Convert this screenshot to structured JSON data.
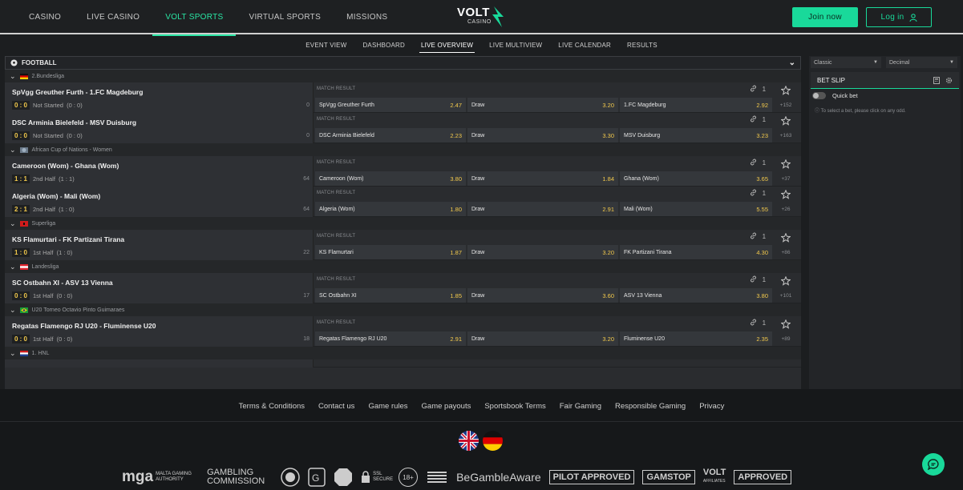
{
  "nav": {
    "items": [
      "CASINO",
      "LIVE CASINO",
      "VOLT SPORTS",
      "VIRTUAL SPORTS",
      "MISSIONS"
    ],
    "active_index": 2
  },
  "logo": {
    "title": "VOLT",
    "subtitle": "CASINO"
  },
  "auth": {
    "join_label": "Join now",
    "login_label": "Log in"
  },
  "subnav": {
    "items": [
      "EVENT VIEW",
      "DASHBOARD",
      "LIVE OVERVIEW",
      "LIVE MULTIVIEW",
      "LIVE CALENDAR",
      "RESULTS"
    ],
    "active_index": 2
  },
  "sport": {
    "label": "FOOTBALL"
  },
  "market_label": "MATCH RESULT",
  "leagues": [
    {
      "name": "2.Bundesliga",
      "flag": "germany",
      "matches": [
        {
          "name": "SpVgg Greuther Furth - 1.FC Magdeburg",
          "score": "0 : 0",
          "status": "Not Started",
          "period": "(0 : 0)",
          "minute": "0",
          "links": "1",
          "home": "SpVgg Greuther Furth",
          "home_odd": "2.47",
          "draw": "Draw",
          "draw_odd": "3.20",
          "away": "1.FC Magdeburg",
          "away_odd": "2.92",
          "more": "+152"
        },
        {
          "name": "DSC Arminia Bielefeld - MSV Duisburg",
          "score": "0 : 0",
          "status": "Not Started",
          "period": "(0 : 0)",
          "minute": "0",
          "links": "1",
          "home": "DSC Arminia Bielefeld",
          "home_odd": "2.23",
          "draw": "Draw",
          "draw_odd": "3.30",
          "away": "MSV Duisburg",
          "away_odd": "3.23",
          "more": "+163"
        }
      ]
    },
    {
      "name": "African Cup of Nations - Women",
      "flag": "world",
      "matches": [
        {
          "name": "Cameroon (Wom) - Ghana (Wom)",
          "score": "1 : 1",
          "status": "2nd Half",
          "period": "(1 : 1)",
          "minute": "64",
          "links": "1",
          "home": "Cameroon (Wom)",
          "home_odd": "3.80",
          "draw": "Draw",
          "draw_odd": "1.84",
          "away": "Ghana (Wom)",
          "away_odd": "3.65",
          "more": "+37"
        },
        {
          "name": "Algeria (Wom) - Mali (Wom)",
          "score": "2 : 1",
          "status": "2nd Half",
          "period": "(1 : 0)",
          "minute": "64",
          "links": "1",
          "home": "Algeria (Wom)",
          "home_odd": "1.80",
          "draw": "Draw",
          "draw_odd": "2.91",
          "away": "Mali (Wom)",
          "away_odd": "5.55",
          "more": "+26"
        }
      ]
    },
    {
      "name": "Superliga",
      "flag": "albania",
      "matches": [
        {
          "name": "KS Flamurtari - FK Partizani Tirana",
          "score": "1 : 0",
          "status": "1st Half",
          "period": "(1 : 0)",
          "minute": "22",
          "links": "1",
          "home": "KS Flamurtari",
          "home_odd": "1.87",
          "draw": "Draw",
          "draw_odd": "3.20",
          "away": "FK Partizani Tirana",
          "away_odd": "4.30",
          "more": "+86"
        }
      ]
    },
    {
      "name": "Landesliga",
      "flag": "austria",
      "matches": [
        {
          "name": "SC Ostbahn XI - ASV 13 Vienna",
          "score": "0 : 0",
          "status": "1st Half",
          "period": "(0 : 0)",
          "minute": "17",
          "links": "1",
          "home": "SC Ostbahn XI",
          "home_odd": "1.85",
          "draw": "Draw",
          "draw_odd": "3.60",
          "away": "ASV 13 Vienna",
          "away_odd": "3.80",
          "more": "+101"
        }
      ]
    },
    {
      "name": "U20 Torneo Octavio Pinto Guimaraes",
      "flag": "brazil",
      "matches": [
        {
          "name": "Regatas Flamengo RJ U20 - Fluminense U20",
          "score": "0 : 0",
          "status": "1st Half",
          "period": "(0 : 0)",
          "minute": "18",
          "links": "1",
          "home": "Regatas Flamengo RJ U20",
          "home_odd": "2.91",
          "draw": "Draw",
          "draw_odd": "3.20",
          "away": "Fluminense U20",
          "away_odd": "2.35",
          "more": "+89"
        }
      ]
    },
    {
      "name": "1. HNL",
      "flag": "croatia",
      "matches": []
    }
  ],
  "sidebar": {
    "view_select": "Classic",
    "odds_select": "Decimal",
    "betslip_title": "BET SLIP",
    "quick_bet_label": "Quick bet",
    "hint": "To select a bet, please click on any odd."
  },
  "footer": {
    "links": [
      "Terms & Conditions",
      "Contact us",
      "Game rules",
      "Game payouts",
      "Sportsbook Terms",
      "Fair Gaming",
      "Responsible Gaming",
      "Privacy"
    ],
    "partners": {
      "mga": "mga",
      "mga_sub": "MALTA GAMING AUTHORITY",
      "gc": "GAMBLING COMMISSION",
      "bga": "BeGambleAware",
      "pilot": "PILOT APPROVED",
      "gamstop": "GAMSTOP",
      "volt_aff": "VOLT",
      "volt_aff_sub": "AFFILIATES",
      "casino_approved": "APPROVED",
      "age": "18+",
      "ssl": "SSL SECURE"
    }
  },
  "colors": {
    "accent": "#19d99a",
    "odd": "#f2c94c",
    "bg": "#1c1e20"
  }
}
